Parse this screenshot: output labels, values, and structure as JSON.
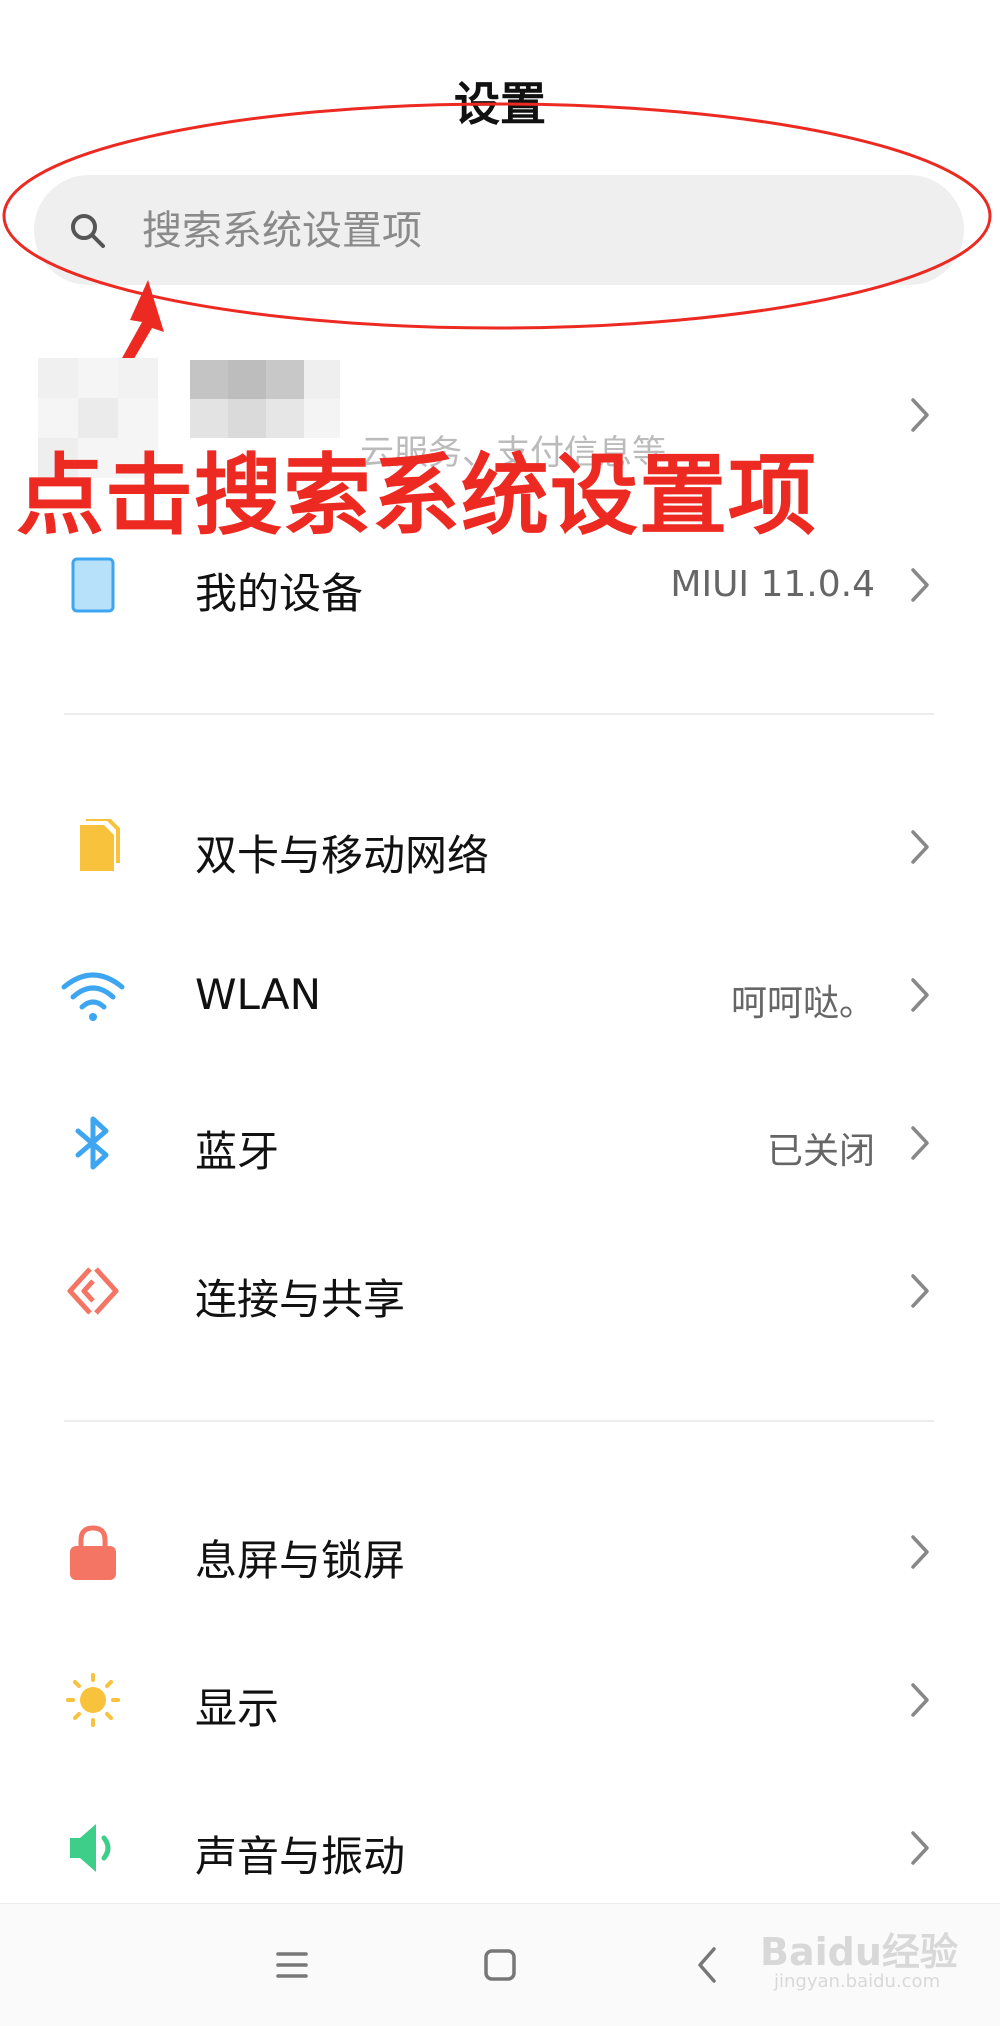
{
  "header": {
    "title": "设置"
  },
  "search": {
    "placeholder": "搜索系统设置项"
  },
  "annotation": {
    "text": "点击搜索系统设置项",
    "color": "#ec2a22"
  },
  "account": {
    "subtitle": "云服务、支付信息等"
  },
  "sections": [
    {
      "items": [
        {
          "label": "我的设备",
          "value": "MIUI 11.0.4",
          "icon": "phone-icon"
        }
      ]
    },
    {
      "items": [
        {
          "label": "双卡与移动网络",
          "value": "",
          "icon": "sim-card-icon"
        },
        {
          "label": "WLAN",
          "value": "呵呵哒。",
          "icon": "wifi-icon"
        },
        {
          "label": "蓝牙",
          "value": "已关闭",
          "icon": "bluetooth-icon"
        },
        {
          "label": "连接与共享",
          "value": "",
          "icon": "share-icon"
        }
      ]
    },
    {
      "items": [
        {
          "label": "息屏与锁屏",
          "value": "",
          "icon": "lock-icon"
        },
        {
          "label": "显示",
          "value": "",
          "icon": "sun-icon"
        },
        {
          "label": "声音与振动",
          "value": "",
          "icon": "speaker-icon"
        }
      ]
    }
  ],
  "navbar": {
    "buttons": [
      "menu-icon",
      "home-icon",
      "back-icon"
    ]
  },
  "watermark": {
    "text": "Baidu经验",
    "sub": "jingyan.baidu.com"
  },
  "colors": {
    "accent_red": "#ec2a22",
    "wifi_blue": "#3ea6f0",
    "sim_yellow": "#f9c23c",
    "lock_red": "#f47563",
    "speaker_green": "#3dcf8a"
  }
}
